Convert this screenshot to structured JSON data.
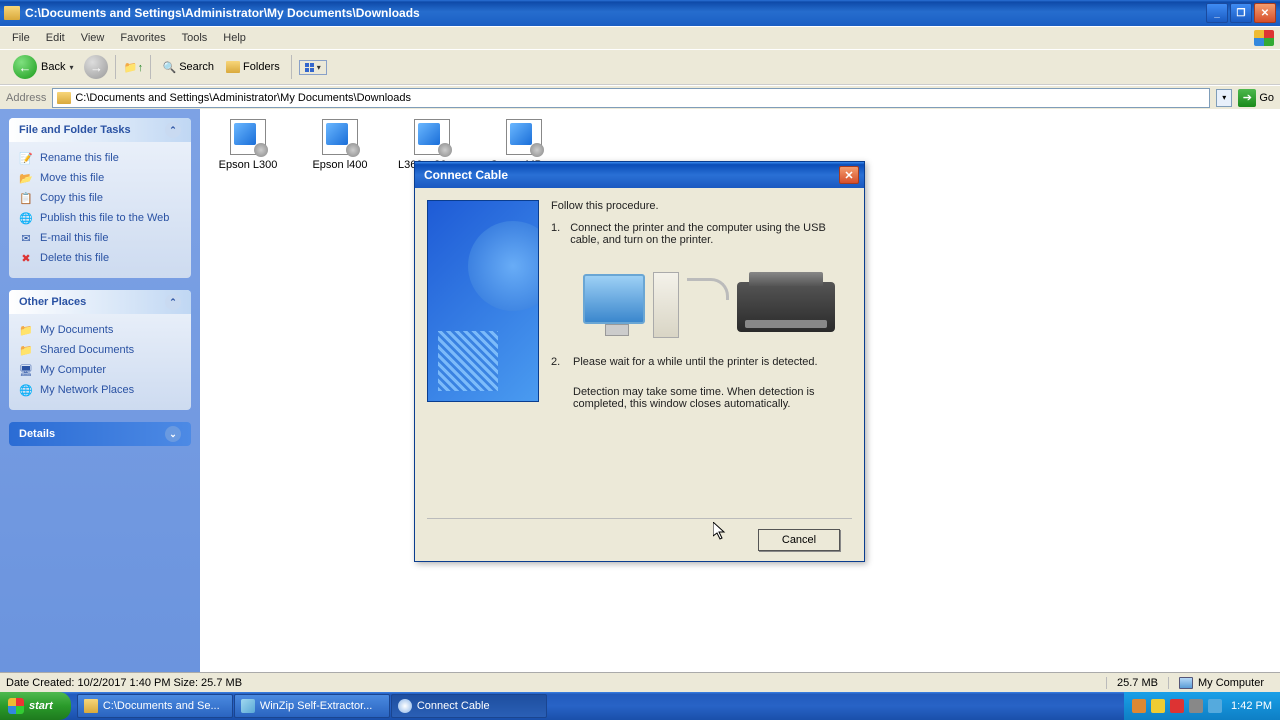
{
  "window": {
    "title": "C:\\Documents and Settings\\Administrator\\My Documents\\Downloads"
  },
  "menubar": {
    "file": "File",
    "edit": "Edit",
    "view": "View",
    "favorites": "Favorites",
    "tools": "Tools",
    "help": "Help"
  },
  "toolbar": {
    "back": "Back",
    "search": "Search",
    "folders": "Folders"
  },
  "address": {
    "label": "Address",
    "path": "C:\\Documents and Settings\\Administrator\\My Documents\\Downloads",
    "go": "Go"
  },
  "sidebar_tasks": {
    "header": "File and Folder Tasks",
    "rename": "Rename this file",
    "move": "Move this file",
    "copy": "Copy this file",
    "publish": "Publish this file to the Web",
    "email": "E-mail this file",
    "delete": "Delete this file"
  },
  "sidebar_places": {
    "header": "Other Places",
    "docs": "My Documents",
    "shared": "Shared Documents",
    "computer": "My Computer",
    "network": "My Network Places"
  },
  "sidebar_details": {
    "header": "Details"
  },
  "files": {
    "f0": "Epson L300",
    "f1": "Epson l400",
    "f2": "L360_x86_2...",
    "f3": "Canon MP230"
  },
  "dialog": {
    "title": "Connect Cable",
    "follow": "Follow this procedure.",
    "num1": "1.",
    "step1": "Connect the printer and the computer using the USB cable, and turn on the printer.",
    "num2": "2.",
    "step2": "Please wait for a while until the printer is detected.",
    "note": "Detection may take some time. When detection is completed, this window closes automatically.",
    "cancel": "Cancel"
  },
  "statusbar": {
    "left": "Date Created: 10/2/2017 1:40 PM Size: 25.7 MB",
    "size": "25.7 MB",
    "location": "My Computer"
  },
  "taskbar": {
    "start": "start",
    "tb0": "C:\\Documents and Se...",
    "tb1": "WinZip Self-Extractor...",
    "tb2": "Connect Cable",
    "clock": "1:42 PM"
  }
}
